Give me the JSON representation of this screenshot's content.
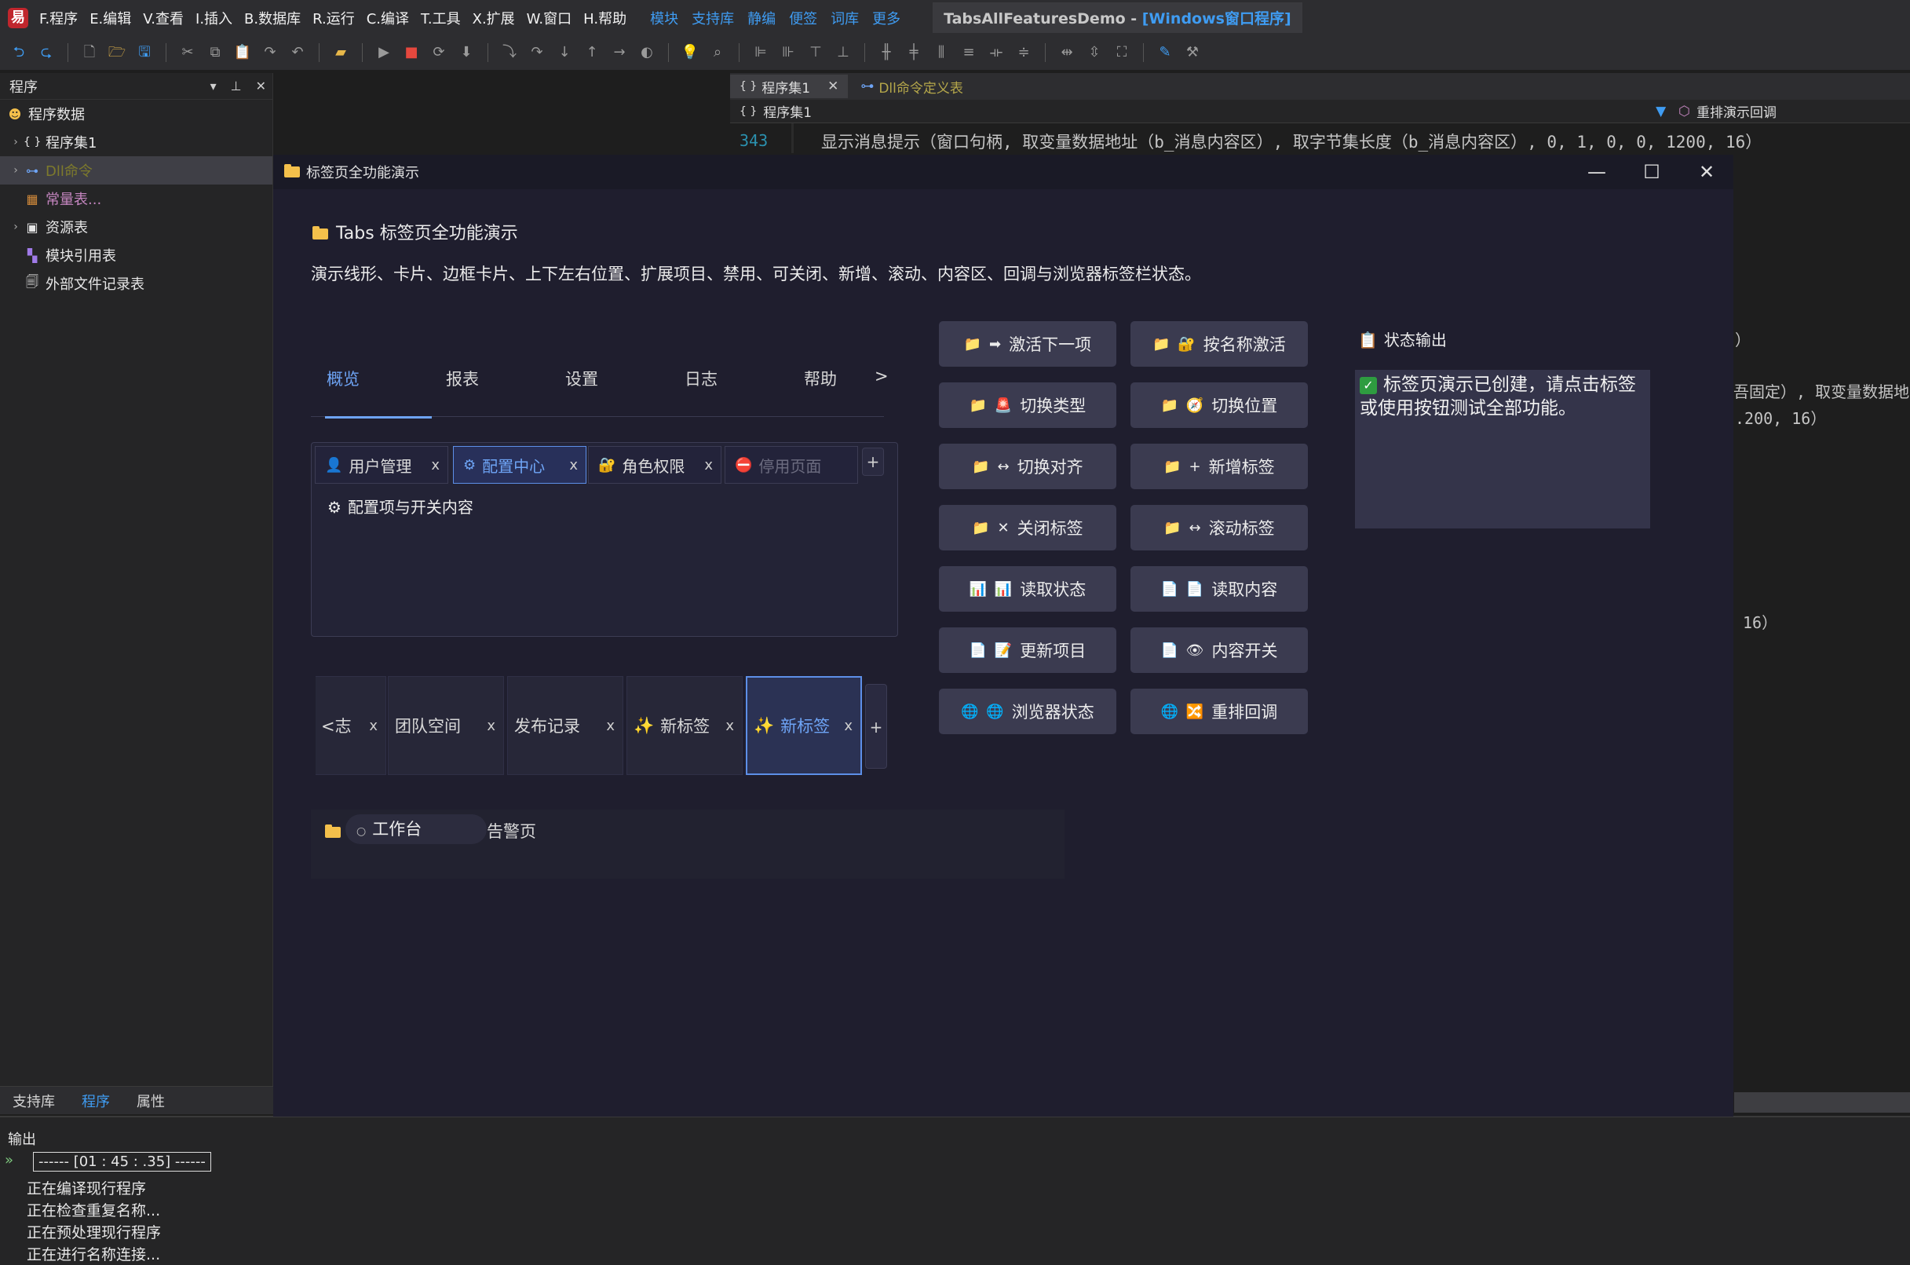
{
  "menubar": {
    "menus": [
      "F.程序",
      "E.编辑",
      "V.查看",
      "I.插入",
      "B.数据库",
      "R.运行",
      "C.编译",
      "T.工具",
      "X.扩展",
      "W.窗口",
      "H.帮助"
    ],
    "links": [
      "模块",
      "支持库",
      "静编",
      "便签",
      "词库",
      "更多"
    ],
    "title_prefix": "TabsAllFeaturesDemo - ",
    "title_highlight": "[Windows窗口程序]"
  },
  "left_panel": {
    "title": "程序",
    "items": [
      {
        "label": "程序数据"
      },
      {
        "label": "程序集1"
      },
      {
        "label": "Dll命令"
      },
      {
        "label": "常量表..."
      },
      {
        "label": "资源表"
      },
      {
        "label": "模块引用表"
      },
      {
        "label": "外部文件记录表"
      }
    ],
    "bottom_tabs": [
      "支持库",
      "程序",
      "属性"
    ]
  },
  "editor": {
    "tabs": [
      "程序集1",
      "Dll命令定义表"
    ],
    "nav_left": "程序集1",
    "nav_right": "重排演示回调",
    "line_number": "343",
    "code": "显示消息提示（窗口句柄, 取变量数据地址（b_消息内容区）, 取字节集长度（b_消息内容区）, 0, 1, 0, 0, 1200, 16）",
    "frag1": "）",
    "frag2": "吾固定）, 取变量数据地",
    "frag3": ".200, 16）",
    "frag4": "16）"
  },
  "output": {
    "title": "输出",
    "stamp": "------ [01 : 45 : .35] ------",
    "lines": [
      "正在编译现行程序",
      "正在检查重复名称...",
      "正在预处理现行程序",
      "正在进行名称连接..."
    ]
  },
  "demo_window": {
    "title": "标签页全功能演示",
    "header": {
      "title": "Tabs 标签页全功能演示",
      "desc": "演示线形、卡片、边框卡片、上下左右位置、扩展项目、禁用、可关闭、新增、滚动、内容区、回调与浏览器标签栏状态。"
    },
    "line_tabs": {
      "items": [
        "概览",
        "报表",
        "设置",
        "日志",
        "帮助"
      ],
      "more": ">",
      "active_index": 0
    },
    "card_tabs": {
      "items": [
        {
          "label": "用户管理",
          "icon": "user-icon",
          "close": "x"
        },
        {
          "label": "配置中心",
          "icon": "gear-icon",
          "close": "x"
        },
        {
          "label": "角色权限",
          "icon": "lock-icon",
          "close": "x"
        },
        {
          "label": "停用页面",
          "icon": "no-entry-icon"
        }
      ],
      "add": "+",
      "active_index": 1,
      "content": "配置项与开关内容"
    },
    "border_tabs": {
      "items": [
        {
          "label": "<志",
          "close": "x"
        },
        {
          "label": "团队空间",
          "close": "x"
        },
        {
          "label": "发布记录",
          "close": "x"
        },
        {
          "label": "新标签",
          "close": "x",
          "icon": "sparkle-icon"
        },
        {
          "label": "新标签",
          "close": "x",
          "icon": "sparkle-icon"
        }
      ],
      "add": "+",
      "active_index": 4
    },
    "extras": {
      "pill": "工作台",
      "side": "告警页"
    },
    "buttons": [
      {
        "label": "激活下一项",
        "icons": "📁 ➡"
      },
      {
        "label": "按名称激活",
        "icons": "📁 🔐"
      },
      {
        "label": "切换类型",
        "icons": "📁 🚨"
      },
      {
        "label": "切换位置",
        "icons": "📁 🧭"
      },
      {
        "label": "切换对齐",
        "icons": "📁 ↔"
      },
      {
        "label": "新增标签",
        "icons": "📁 +"
      },
      {
        "label": "关闭标签",
        "icons": "📁 ✕"
      },
      {
        "label": "滚动标签",
        "icons": "📁 ↔"
      },
      {
        "label": "读取状态",
        "icons": "📊 📊"
      },
      {
        "label": "读取内容",
        "icons": "📄 📄"
      },
      {
        "label": "更新项目",
        "icons": "📄 📝"
      },
      {
        "label": "内容开关",
        "icons": "📄 👁"
      },
      {
        "label": "浏览器状态",
        "icons": "🌐 🌐"
      },
      {
        "label": "重排回调",
        "icons": "🌐 🔀"
      }
    ],
    "status": {
      "title": "状态输出",
      "text": "标签页演示已创建，请点击标签或使用按钮测试全部功能。"
    }
  }
}
